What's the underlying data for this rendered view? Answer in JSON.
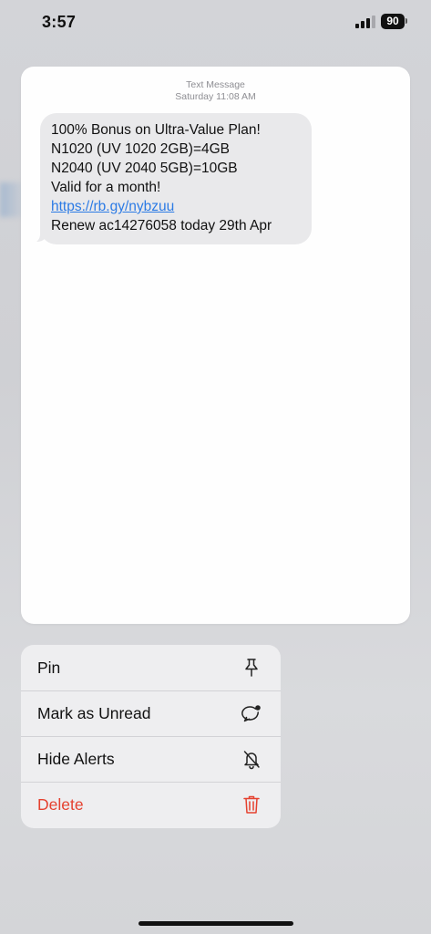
{
  "status_bar": {
    "time": "3:57",
    "battery_level": "90",
    "signal_bars_active": 3,
    "signal_bars_total": 4
  },
  "message_preview": {
    "header_type": "Text Message",
    "header_timestamp": "Saturday 11:08 AM",
    "lines": [
      "100% Bonus on Ultra-Value Plan!",
      "N1020 (UV 1020 2GB)=4GB",
      "N2040 (UV 2040 5GB)=10GB",
      "Valid for a month!"
    ],
    "link_text": "https://rb.gy/nybzuu",
    "last_line": "Renew ac14276058 today 29th Apr",
    "bubble_color": "#e9e9eb",
    "link_color": "#2c7be5"
  },
  "context_menu": {
    "items": [
      {
        "label": "Pin",
        "icon": "pin-icon"
      },
      {
        "label": "Mark as Unread",
        "icon": "mark-unread-icon"
      },
      {
        "label": "Hide Alerts",
        "icon": "bell-slash-icon"
      },
      {
        "label": "Delete",
        "icon": "trash-icon"
      }
    ],
    "destructive_color": "#e5412f"
  }
}
